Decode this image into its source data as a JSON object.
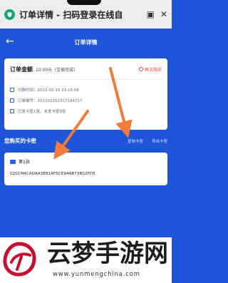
{
  "browser": {
    "title": "订单详情 - 扫码登录在线自",
    "icons": [
      "photo-icon",
      "close-icon"
    ]
  },
  "nav": {
    "back_label": "←",
    "title": "订单详情"
  },
  "order": {
    "amount_label": "订单金额",
    "amount_value": "10.00元（交易完成）",
    "rebuy_label": "再次购买",
    "rows": [
      {
        "icon": "clock-icon",
        "text": "付款时间：2022-02-15 23:15:06"
      },
      {
        "icon": "document-icon",
        "text": "订单编号：202202152317194717"
      },
      {
        "icon": "card-icon",
        "text": "已发卡密1张，未发卡密0张"
      }
    ]
  },
  "cards_section": {
    "title": "您购买的卡密",
    "copy_label": "复制卡密",
    "export_label": "导出卡密"
  },
  "card_item": {
    "label": "第1张",
    "code": "0201M4CADAA3E81AF5CE94AB73B02FD5"
  },
  "watermark": {
    "brand": "云梦手游网",
    "url": "www.yunmengchina.com"
  },
  "colors": {
    "background": "#1f55d8",
    "arrow": "#f07b3a",
    "accent_red": "#e53935"
  }
}
